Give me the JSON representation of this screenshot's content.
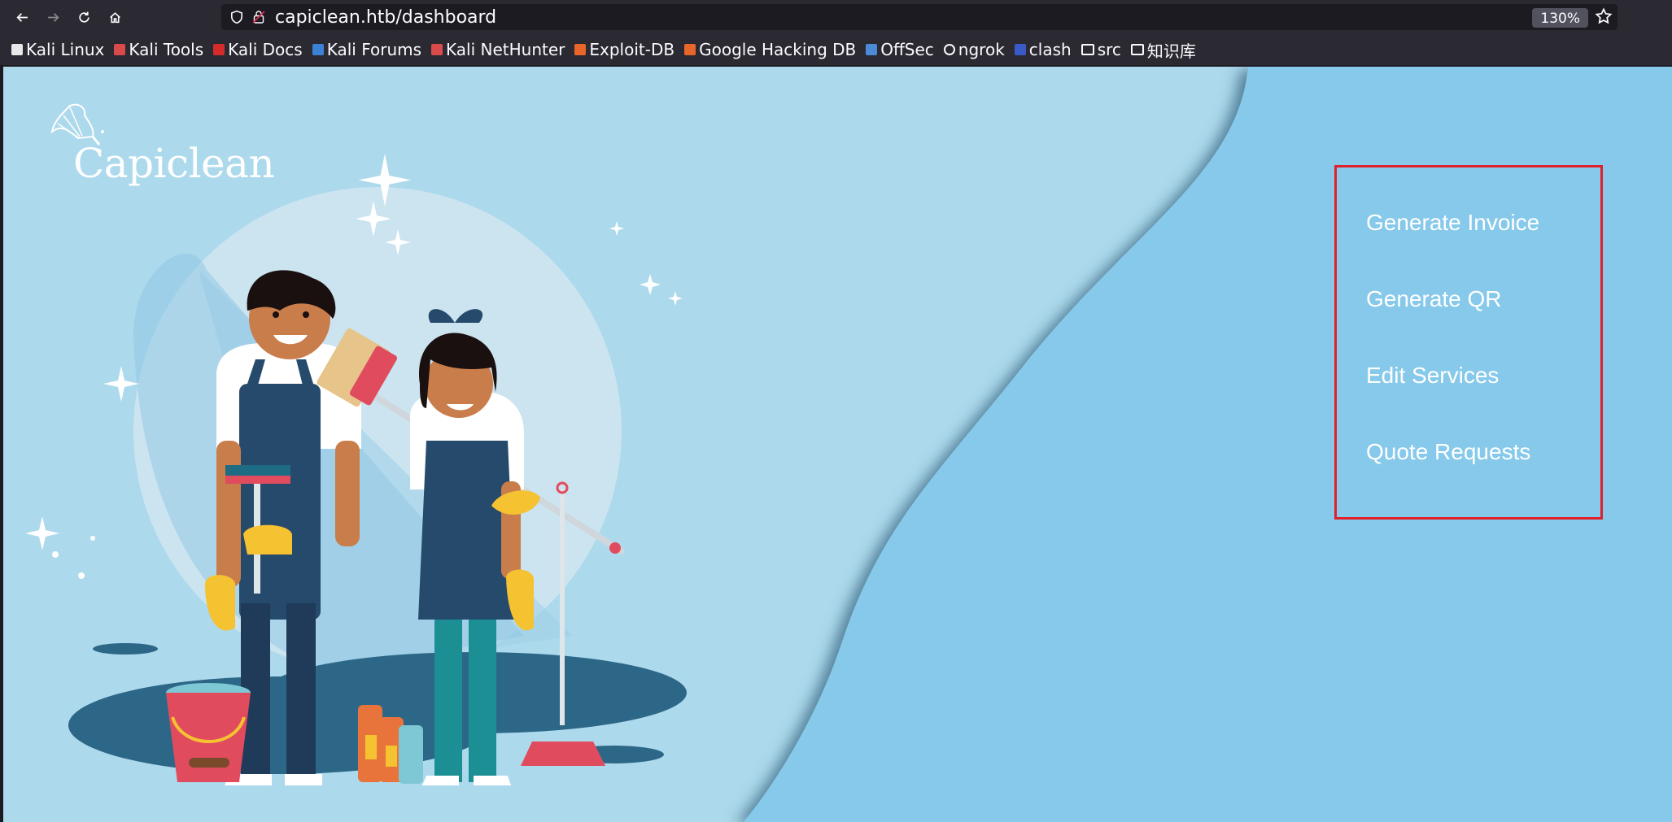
{
  "browser": {
    "url": "capiclean.htb/dashboard",
    "zoom": "130%",
    "bookmarks": [
      {
        "label": "Kali Linux",
        "icon": "kali-dragon-icon",
        "color": "#e8e8e8"
      },
      {
        "label": "Kali Tools",
        "icon": "kali-tools-icon",
        "color": "#d94a4a"
      },
      {
        "label": "Kali Docs",
        "icon": "kali-docs-icon",
        "color": "#d62b2b"
      },
      {
        "label": "Kali Forums",
        "icon": "kali-forums-icon",
        "color": "#3b82d6"
      },
      {
        "label": "Kali NetHunter",
        "icon": "kali-nethunter-icon",
        "color": "#d94a4a"
      },
      {
        "label": "Exploit-DB",
        "icon": "exploit-db-icon",
        "color": "#e8662a"
      },
      {
        "label": "Google Hacking DB",
        "icon": "ghdb-icon",
        "color": "#e8662a"
      },
      {
        "label": "OffSec",
        "icon": "offsec-icon",
        "color": "#4a8ad6"
      },
      {
        "label": "ngrok",
        "icon": "globe-icon",
        "color": "#fbfbfe"
      },
      {
        "label": "clash",
        "icon": "clash-icon",
        "color": "#3a5ac8"
      },
      {
        "label": "src",
        "icon": "folder-icon",
        "color": "#fbfbfe"
      },
      {
        "label": "知识库",
        "icon": "folder-icon",
        "color": "#fbfbfe"
      }
    ]
  },
  "page": {
    "logo_text": "Capiclean",
    "menu": [
      {
        "label": "Generate Invoice"
      },
      {
        "label": "Generate QR"
      },
      {
        "label": "Edit Services"
      },
      {
        "label": "Quote Requests"
      }
    ]
  },
  "colors": {
    "bg_light": "#add9ec",
    "bg_wave": "#87c9ea",
    "menu_border": "#e0202a",
    "shadow": "#2f5d78"
  }
}
